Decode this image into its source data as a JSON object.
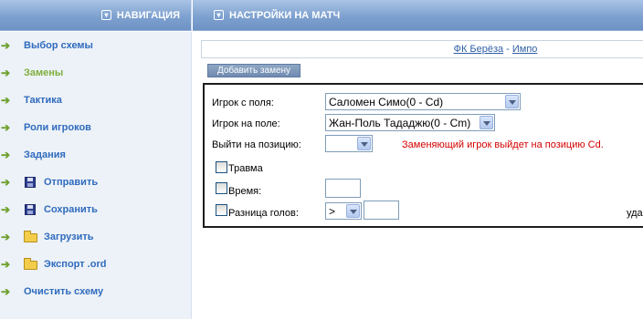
{
  "header": {
    "nav_title": "НАВИГАЦИЯ",
    "settings_title": "НАСТРОЙКИ НА МАТЧ"
  },
  "sidebar": {
    "items": [
      {
        "label": "Выбор схемы",
        "icon": "arrow-right-icon"
      },
      {
        "label": "Замены",
        "icon": "arrow-right-icon",
        "active": true
      },
      {
        "label": "Тактика",
        "icon": "arrow-right-icon"
      },
      {
        "label": "Роли игроков",
        "icon": "arrow-right-icon"
      },
      {
        "label": "Задания",
        "icon": "arrow-right-icon"
      },
      {
        "label": "Отправить",
        "icon": "floppy-disk-icon"
      },
      {
        "label": "Сохранить",
        "icon": "floppy-disk-icon"
      },
      {
        "label": "Загрузить",
        "icon": "folder-icon"
      },
      {
        "label": "Экспорт .ord",
        "icon": "folder-icon"
      },
      {
        "label": "Очистить схему",
        "icon": "arrow-right-icon"
      }
    ]
  },
  "match": {
    "home_team": "ФК Берёза",
    "separator": "-",
    "away_team": "Импо"
  },
  "substitution": {
    "add_button": "Добавить замену",
    "player_off_label": "Игрок с поля:",
    "player_off_value": "Саломен Симо(0 - Cd)",
    "player_on_label": "Игрок на поле:",
    "player_on_value": "Жан-Поль Тададжю(0 - Cm)",
    "position_label": "Выйти на позицию:",
    "position_value": "",
    "position_note": "Заменяющий игрок выйдет на позицию Cd.",
    "injury_label": "Травма",
    "time_label": "Время:",
    "time_value": "",
    "goal_diff_label": "Разница голов:",
    "goal_diff_operator": ">",
    "goal_diff_value": "",
    "truncated_right": "уда"
  },
  "colors": {
    "link": "#2f6bbd",
    "active": "#7fae3a",
    "warning": "#d40000",
    "header": "#7ea1cf"
  }
}
